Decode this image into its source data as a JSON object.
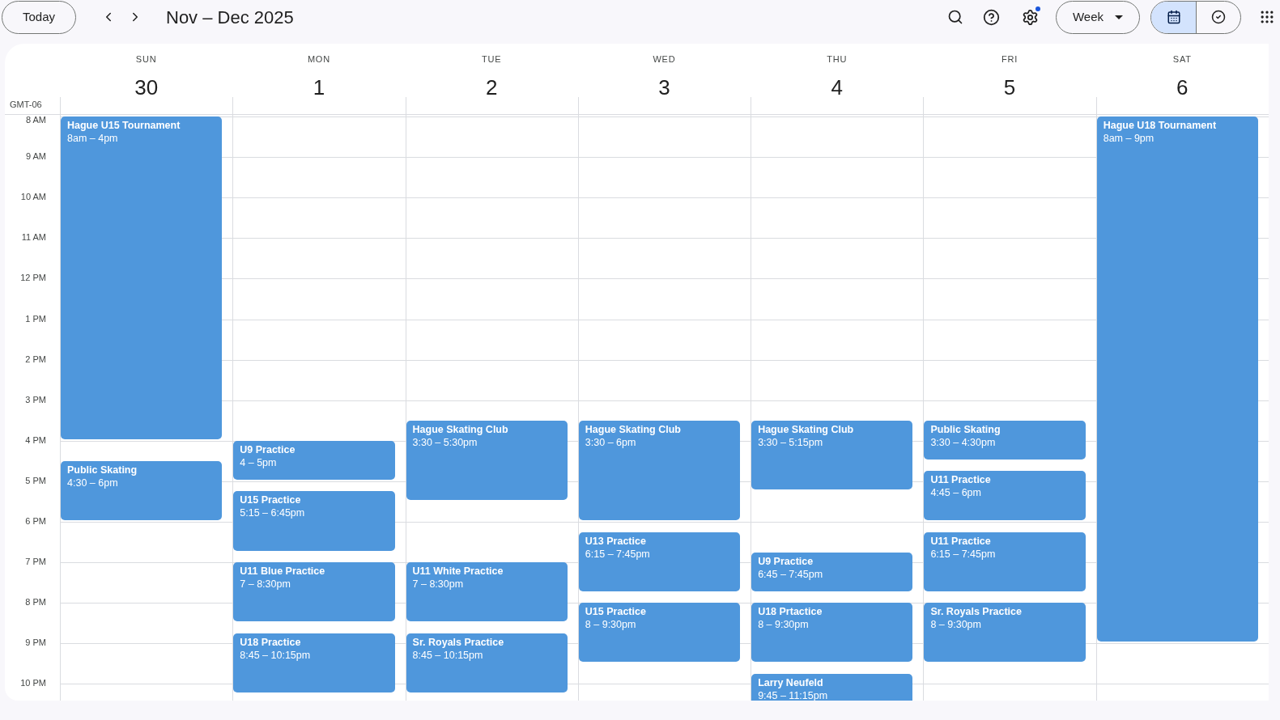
{
  "toolbar": {
    "today_button": "Today",
    "title": "Nov – Dec 2025",
    "view_button": "Week",
    "settings_notification": true,
    "modes": [
      {
        "kind": "calendar",
        "selected": true
      },
      {
        "kind": "tasks",
        "selected": false
      }
    ]
  },
  "timezone": "GMT-06",
  "hours": [
    "8 AM",
    "9 AM",
    "10 AM",
    "11 AM",
    "12 PM",
    "1 PM",
    "2 PM",
    "3 PM",
    "4 PM",
    "5 PM",
    "6 PM",
    "7 PM",
    "8 PM",
    "9 PM",
    "10 PM"
  ],
  "days": [
    {
      "weekday": "SUN",
      "date": "30",
      "events": [
        {
          "title": "Hague U15 Tournament",
          "time": "8am – 4pm"
        },
        {
          "title": "Public Skating",
          "time": "4:30 – 6pm"
        }
      ]
    },
    {
      "weekday": "MON",
      "date": "1",
      "events": [
        {
          "title": "U9 Practice",
          "time": "4 – 5pm"
        },
        {
          "title": "U15 Practice",
          "time": "5:15 – 6:45pm"
        },
        {
          "title": "U11 Blue Practice",
          "time": "7 – 8:30pm"
        },
        {
          "title": "U18 Practice",
          "time": "8:45 – 10:15pm"
        }
      ]
    },
    {
      "weekday": "TUE",
      "date": "2",
      "events": [
        {
          "title": "Hague Skating Club",
          "time": "3:30 – 5:30pm"
        },
        {
          "title": "U11 White Practice",
          "time": "7 – 8:30pm"
        },
        {
          "title": "Sr. Royals Practice",
          "time": "8:45 – 10:15pm"
        }
      ]
    },
    {
      "weekday": "WED",
      "date": "3",
      "events": [
        {
          "title": "Hague Skating Club",
          "time": "3:30 – 6pm"
        },
        {
          "title": "U13 Practice",
          "time": "6:15 – 7:45pm"
        },
        {
          "title": "U15 Practice",
          "time": "8 – 9:30pm"
        }
      ]
    },
    {
      "weekday": "THU",
      "date": "4",
      "events": [
        {
          "title": "Hague Skating Club",
          "time": "3:30 – 5:15pm"
        },
        {
          "title": "U9 Practice",
          "time": "6:45 – 7:45pm"
        },
        {
          "title": "U18 Prtactice",
          "time": "8 – 9:30pm"
        },
        {
          "title": "Larry Neufeld",
          "time": "9:45 – 11:15pm"
        }
      ]
    },
    {
      "weekday": "FRI",
      "date": "5",
      "events": [
        {
          "title": "Public Skating",
          "time": "3:30 – 4:30pm"
        },
        {
          "title": "U11 Practice",
          "time": "4:45 – 6pm"
        },
        {
          "title": "U11 Practice",
          "time": "6:15 – 7:45pm"
        },
        {
          "title": "Sr. Royals Practice",
          "time": "8 – 9:30pm"
        }
      ]
    },
    {
      "weekday": "SAT",
      "date": "6",
      "events": [
        {
          "title": "Hague U18 Tournament",
          "time": "8am – 9pm"
        }
      ]
    }
  ]
}
